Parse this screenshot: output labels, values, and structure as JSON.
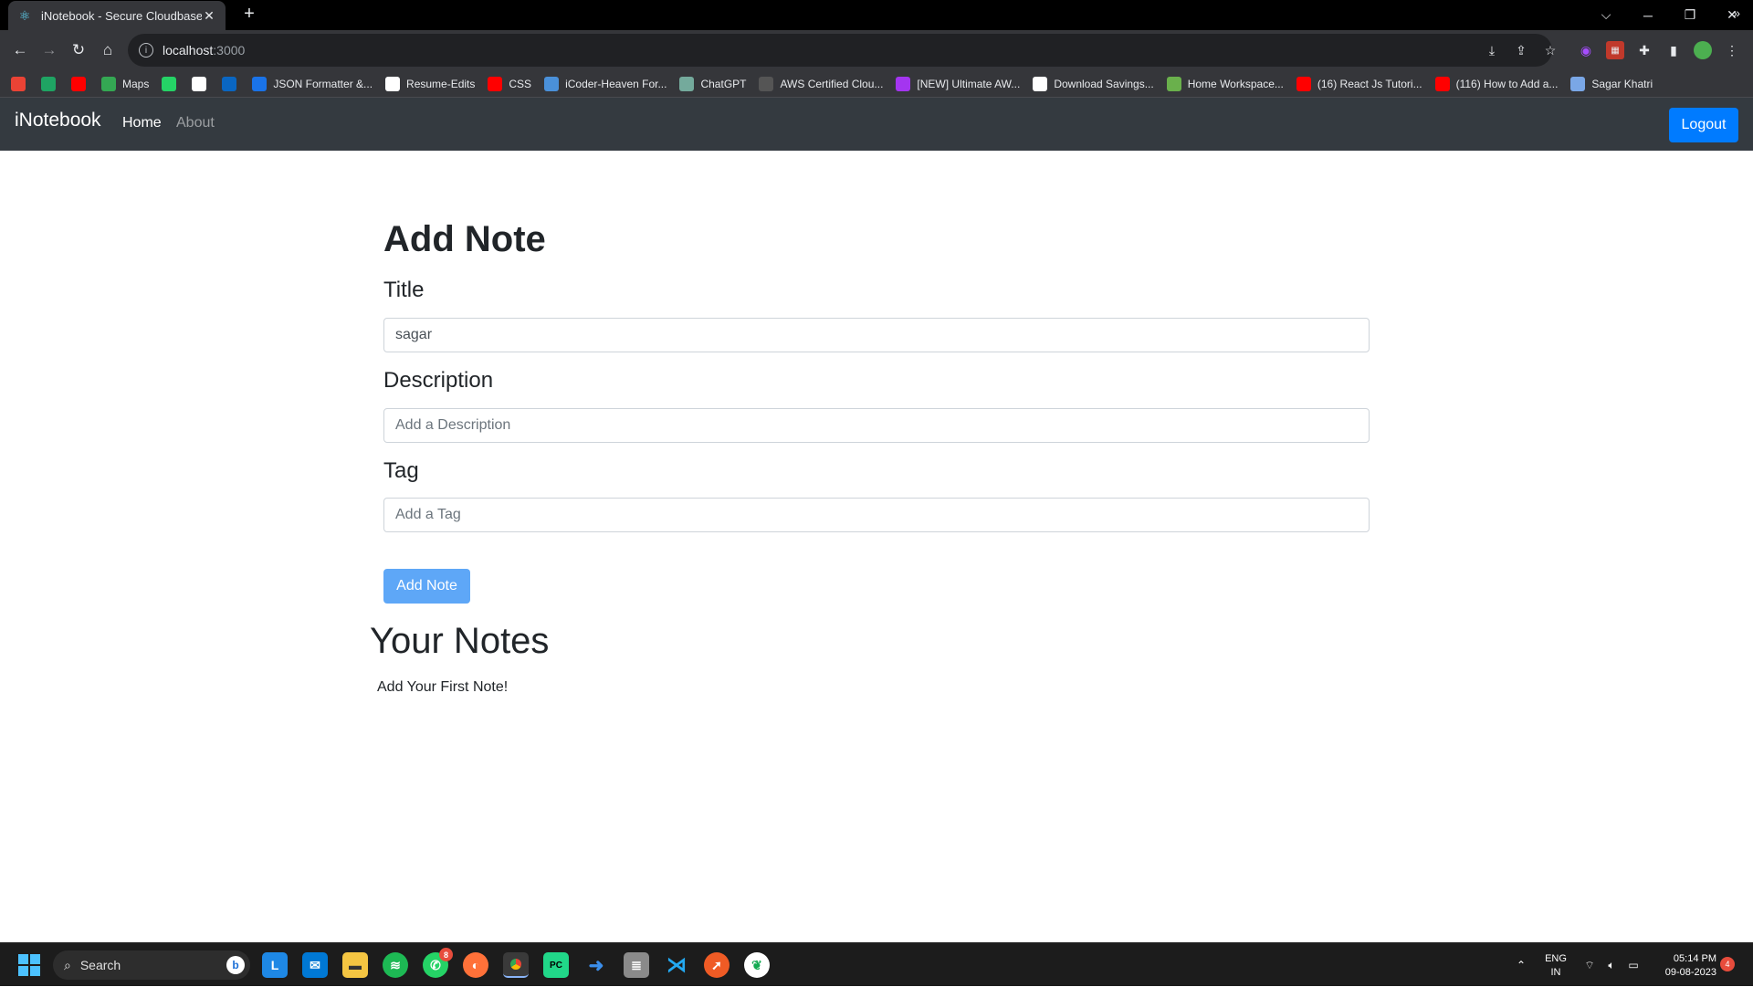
{
  "browser": {
    "tab_title": "iNotebook - Secure Cloudbase N",
    "url_host": "localhost",
    "url_port": ":3000",
    "bookmarks": [
      {
        "label": "",
        "icon": "gmail-icon",
        "color": "#ea4335"
      },
      {
        "label": "",
        "icon": "drive-icon",
        "color": "#1fa463"
      },
      {
        "label": "",
        "icon": "youtube-icon",
        "color": "#ff0000"
      },
      {
        "label": "Maps",
        "icon": "maps-icon",
        "color": "#34a853"
      },
      {
        "label": "",
        "icon": "whatsapp-icon",
        "color": "#25d366"
      },
      {
        "label": "",
        "icon": "github-icon",
        "color": "#ffffff"
      },
      {
        "label": "",
        "icon": "linkedin-icon",
        "color": "#0a66c2"
      },
      {
        "label": "JSON Formatter &...",
        "icon": "check-icon",
        "color": "#1a73e8"
      },
      {
        "label": "Resume-Edits",
        "icon": "play-icon",
        "color": "#ffffff"
      },
      {
        "label": "CSS",
        "icon": "youtube-icon",
        "color": "#ff0000"
      },
      {
        "label": "iCoder-Heaven For...",
        "icon": "vscode-icon",
        "color": "#4a90d9"
      },
      {
        "label": "ChatGPT",
        "icon": "chatgpt-icon",
        "color": "#74aa9c"
      },
      {
        "label": "AWS Certified Clou...",
        "icon": "bracket-icon",
        "color": "#555555"
      },
      {
        "label": "[NEW] Ultimate AW...",
        "icon": "udemy-icon",
        "color": "#a435f0"
      },
      {
        "label": "Download Savings...",
        "icon": "globe-icon",
        "color": "#ffffff"
      },
      {
        "label": "Home Workspace...",
        "icon": "workspace-icon",
        "color": "#6ab04c"
      },
      {
        "label": "(16) React Js Tutori...",
        "icon": "youtube-icon",
        "color": "#ff0000"
      },
      {
        "label": "(116) How to Add a...",
        "icon": "youtube-icon",
        "color": "#ff0000"
      },
      {
        "label": "Sagar Khatri",
        "icon": "person-icon",
        "color": "#7aa7e6"
      }
    ]
  },
  "navbar": {
    "brand": "iNotebook",
    "links": [
      "Home",
      "About"
    ],
    "logout": "Logout"
  },
  "form": {
    "heading": "Add Note",
    "title_label": "Title",
    "title_value": "sagar",
    "description_label": "Description",
    "description_placeholder": "Add a Description",
    "tag_label": "Tag",
    "tag_placeholder": "Add a Tag",
    "submit": "Add Note"
  },
  "notes": {
    "heading": "Your Notes",
    "empty_message": "Add Your First Note!"
  },
  "taskbar": {
    "search": "Search",
    "whatsapp_badge": "8",
    "lang_top": "ENG",
    "lang_bottom": "IN",
    "time": "05:14 PM",
    "date": "09-08-2023",
    "notifications": "4"
  }
}
